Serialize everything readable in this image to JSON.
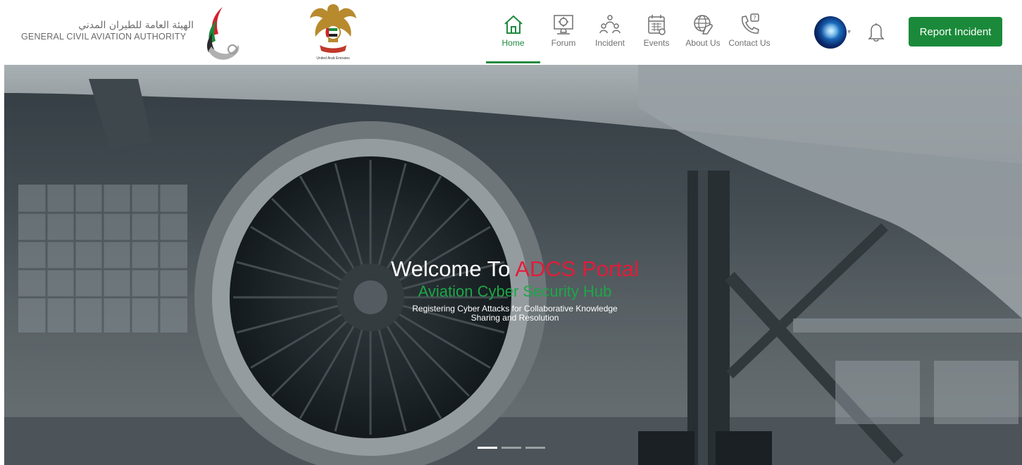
{
  "header": {
    "authority_name_ar": "الهيئة العامة للطيران المدني",
    "authority_name_en": "GENERAL CIVIL AVIATION AUTHORITY",
    "emblem_caption": "United Arab Emirates",
    "gcaa_logo_icon": "gcaa-falcon-logo",
    "emblem_icon": "uae-falcon-emblem"
  },
  "nav": {
    "items": [
      {
        "label": "Home",
        "icon": "home-icon",
        "active": true
      },
      {
        "label": "Forum",
        "icon": "forum-icon",
        "active": false
      },
      {
        "label": "Incident",
        "icon": "incident-icon",
        "active": false
      },
      {
        "label": "Events",
        "icon": "calendar-icon",
        "active": false
      },
      {
        "label": "About Us",
        "icon": "globe-hand-icon",
        "active": false
      },
      {
        "label": "Contact Us",
        "icon": "phone-question-icon",
        "active": false
      }
    ],
    "accent_color": "#1f8a3f"
  },
  "user": {
    "avatar_icon": "user-avatar",
    "dropdown_icon": "chevron-down-icon",
    "notification_icon": "bell-icon"
  },
  "actions": {
    "report_label": "Report Incident",
    "report_color": "#1a8a3a"
  },
  "hero": {
    "title_prefix": "Welcome To ",
    "title_accent": "ADCS Portal",
    "subtitle": "Aviation Cyber Security Hub",
    "description": "Registering Cyber Attacks for Collaborative Knowledge Sharing and Resolution",
    "accent_red": "#e21c3a",
    "accent_green": "#1ea648",
    "carousel_count": 3,
    "carousel_active": 1
  }
}
